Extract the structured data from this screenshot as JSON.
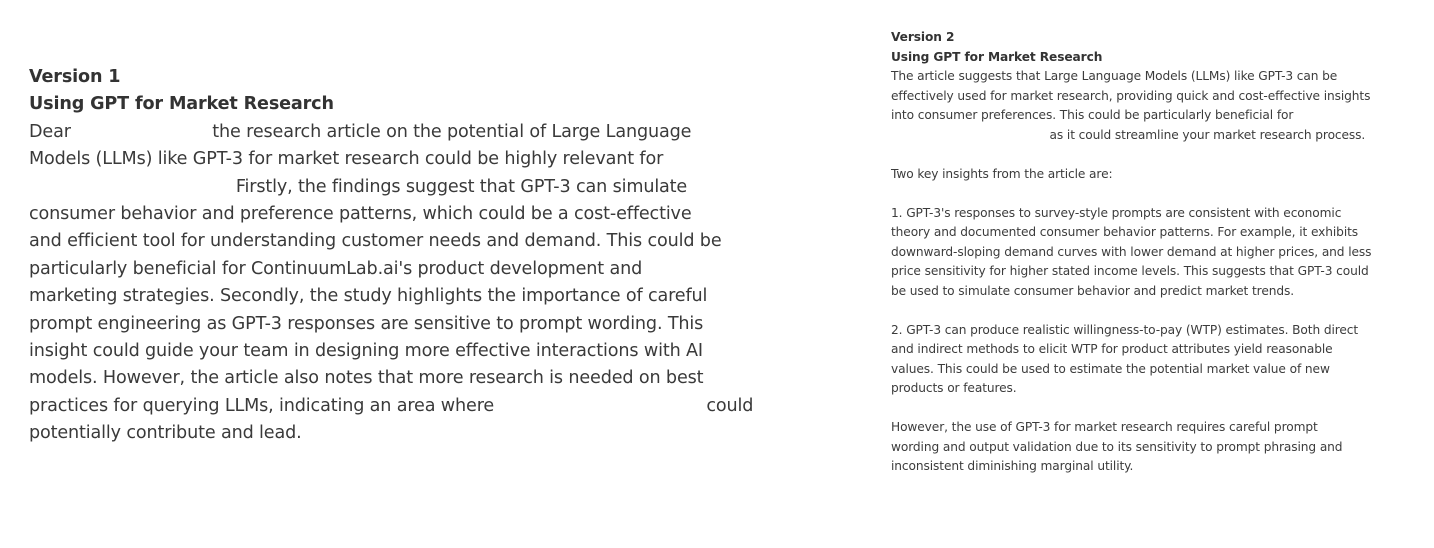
{
  "version1": {
    "label": "Version 1",
    "title": "Using GPT for Market Research",
    "lines": [
      "Dear                          the research article on the potential of Large Language",
      "Models (LLMs) like GPT-3 for market research could be highly relevant for",
      "                                      Firstly, the findings suggest that GPT-3 can simulate",
      "consumer behavior and preference patterns, which could be a cost-effective",
      "and efficient tool for understanding customer needs and demand. This could be",
      "particularly beneficial for ContinuumLab.ai's product development and",
      "marketing strategies. Secondly, the study highlights the importance of careful",
      "prompt engineering as GPT-3 responses are sensitive to prompt wording. This",
      "insight could guide your team in designing more effective interactions with AI",
      "models. However, the article also notes that more research is needed on best",
      "practices for querying LLMs, indicating an area where                                       could",
      "potentially contribute and lead."
    ]
  },
  "version2": {
    "label": "Version 2",
    "title": "Using GPT for Market Research",
    "para1": [
      "The article suggests that Large Language Models (LLMs) like GPT-3 can be",
      "effectively used for market research, providing quick and cost-effective insights",
      "into consumer preferences. This could be particularly beneficial for",
      "                                          as it could streamline your market research process."
    ],
    "para2": [
      "Two key insights from the article are:"
    ],
    "para3": [
      "1. GPT-3's responses to survey-style prompts are consistent with economic",
      "theory and documented consumer behavior patterns. For example, it exhibits",
      "downward-sloping demand curves with lower demand at higher prices, and less",
      "price sensitivity for higher stated income levels. This suggests that GPT-3 could",
      "be used to simulate consumer behavior and predict market trends."
    ],
    "para4": [
      "2. GPT-3 can produce realistic willingness-to-pay (WTP) estimates. Both direct",
      "and indirect methods to elicit WTP for product attributes yield reasonable",
      "values. This could be used to estimate the potential market value of new",
      "products or features."
    ],
    "para5": [
      "However, the use of GPT-3 for market research requires careful prompt",
      "wording and output validation due to its sensitivity to prompt phrasing and",
      "inconsistent diminishing marginal utility."
    ]
  }
}
